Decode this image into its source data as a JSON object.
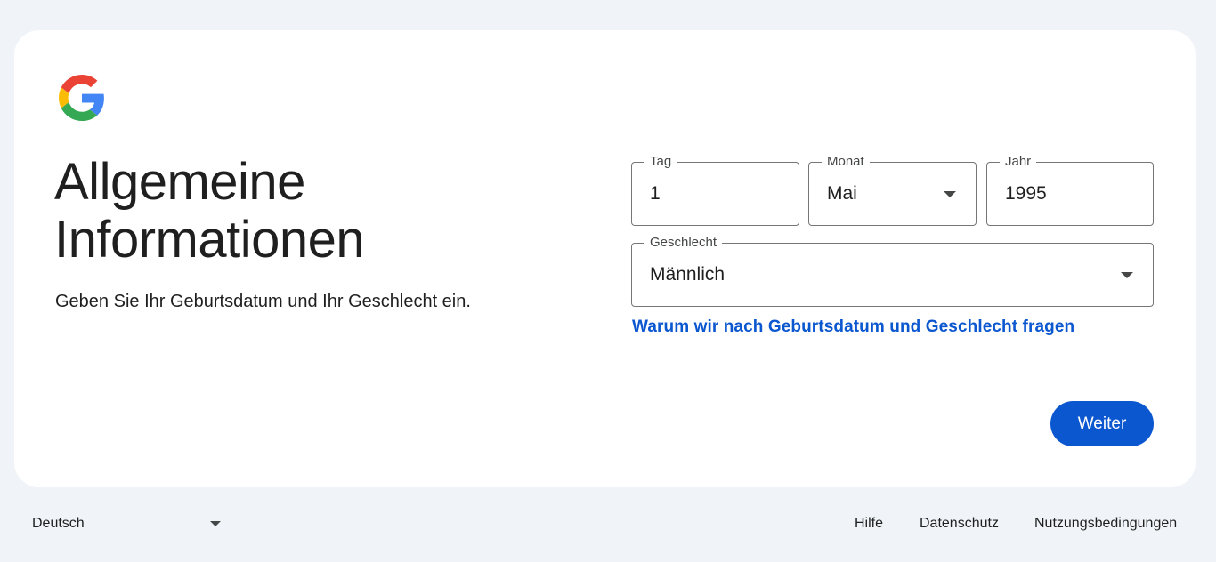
{
  "header": {
    "logo_icon": "google-g-logo"
  },
  "main": {
    "title": "Allgemeine Informationen",
    "subtitle": "Geben Sie Ihr Geburtsdatum und Ihr Geschlecht ein."
  },
  "form": {
    "day": {
      "label": "Tag",
      "value": "1"
    },
    "month": {
      "label": "Monat",
      "value": "Mai"
    },
    "year": {
      "label": "Jahr",
      "value": "1995"
    },
    "gender": {
      "label": "Geschlecht",
      "value": "Männlich"
    },
    "why_link": "Warum wir nach Geburtsdatum und Geschlecht fragen",
    "next_button": "Weiter"
  },
  "footer": {
    "language": "Deutsch",
    "links": [
      "Hilfe",
      "Datenschutz",
      "Nutzungsbedingungen"
    ]
  },
  "colors": {
    "background": "#f0f4f9",
    "card": "#ffffff",
    "accent": "#0b57d0",
    "text": "#1f1f1f",
    "border": "#747775"
  }
}
